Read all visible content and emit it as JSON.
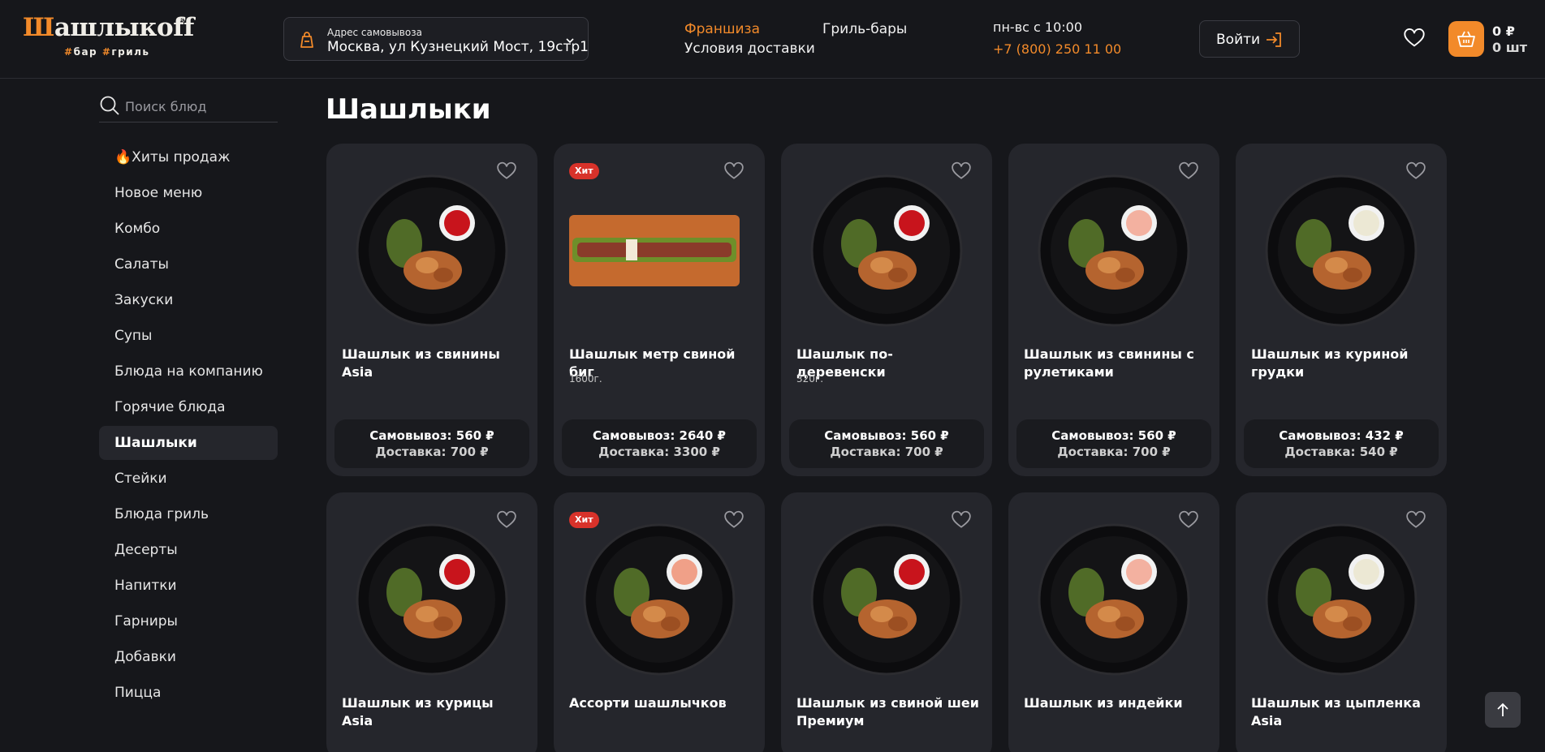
{
  "header": {
    "logo": {
      "wordmark": "Шашлыкoff",
      "reg": "®",
      "tagline": "#бар #гриль"
    },
    "address": {
      "label": "Адрес самовывоза",
      "value": "Москва, ул Кузнецкий Мост, 19стр1"
    },
    "nav": {
      "franchise": "Франшиза",
      "delivery_terms": "Условия доставки",
      "grill_bars": "Гриль-бары"
    },
    "contacts": {
      "hours": "пн-вс с 10:00",
      "phone": "+7 (800) 250 11 00"
    },
    "login_label": "Войти",
    "cart": {
      "sum": "0 ₽",
      "count": "0 шт"
    }
  },
  "sidebar": {
    "search_placeholder": "Поиск блюд",
    "items": [
      {
        "label": "🔥Хиты продаж"
      },
      {
        "label": "Новое меню"
      },
      {
        "label": "Комбо"
      },
      {
        "label": "Салаты"
      },
      {
        "label": "Закуски"
      },
      {
        "label": "Супы"
      },
      {
        "label": "Блюда на компанию"
      },
      {
        "label": "Горячие блюда"
      },
      {
        "label": "Шашлыки"
      },
      {
        "label": "Стейки"
      },
      {
        "label": "Блюда гриль"
      },
      {
        "label": "Десерты"
      },
      {
        "label": "Напитки"
      },
      {
        "label": "Гарниры"
      },
      {
        "label": "Добавки"
      },
      {
        "label": "Пицца"
      }
    ],
    "active_index": 8
  },
  "main": {
    "title": "Шашлыки",
    "products": [
      {
        "name": "Шашлык из свинины Asia",
        "weight": "",
        "badge": "",
        "pickup": "Самовывоз: 560 ₽",
        "delivery": "Доставка: 700 ₽"
      },
      {
        "name": "Шашлык метр свиной биг",
        "weight": "1600г.",
        "badge": "Хит",
        "pickup": "Самовывоз: 2640 ₽",
        "delivery": "Доставка: 3300 ₽"
      },
      {
        "name": "Шашлык по-деревенски",
        "weight": "320г.",
        "badge": "",
        "pickup": "Самовывоз: 560 ₽",
        "delivery": "Доставка: 700 ₽"
      },
      {
        "name": "Шашлык из свинины с рулетиками",
        "weight": "",
        "badge": "",
        "pickup": "Самовывоз: 560 ₽",
        "delivery": "Доставка: 700 ₽"
      },
      {
        "name": "Шашлык из куриной грудки",
        "weight": "",
        "badge": "",
        "pickup": "Самовывоз: 432 ₽",
        "delivery": "Доставка: 540 ₽"
      },
      {
        "name": "Шашлык из курицы Asia",
        "weight": "",
        "badge": ""
      },
      {
        "name": "Ассорти шашлычков",
        "weight": "",
        "badge": "Хит"
      },
      {
        "name": "Шашлык из свиной шеи Премиум",
        "weight": "",
        "badge": ""
      },
      {
        "name": "Шашлык из индейки",
        "weight": "",
        "badge": ""
      },
      {
        "name": "Шашлык из цыпленка Asia",
        "weight": "",
        "badge": ""
      }
    ]
  },
  "colors": {
    "background": "#16171b",
    "card": "#25262c",
    "accent": "#f28a2a",
    "badge": "#d8322a"
  },
  "icons": [
    "bag-icon",
    "chevron-down-icon",
    "login-arrow-icon",
    "heart-icon",
    "basket-icon",
    "search-icon",
    "arrow-up-icon"
  ]
}
